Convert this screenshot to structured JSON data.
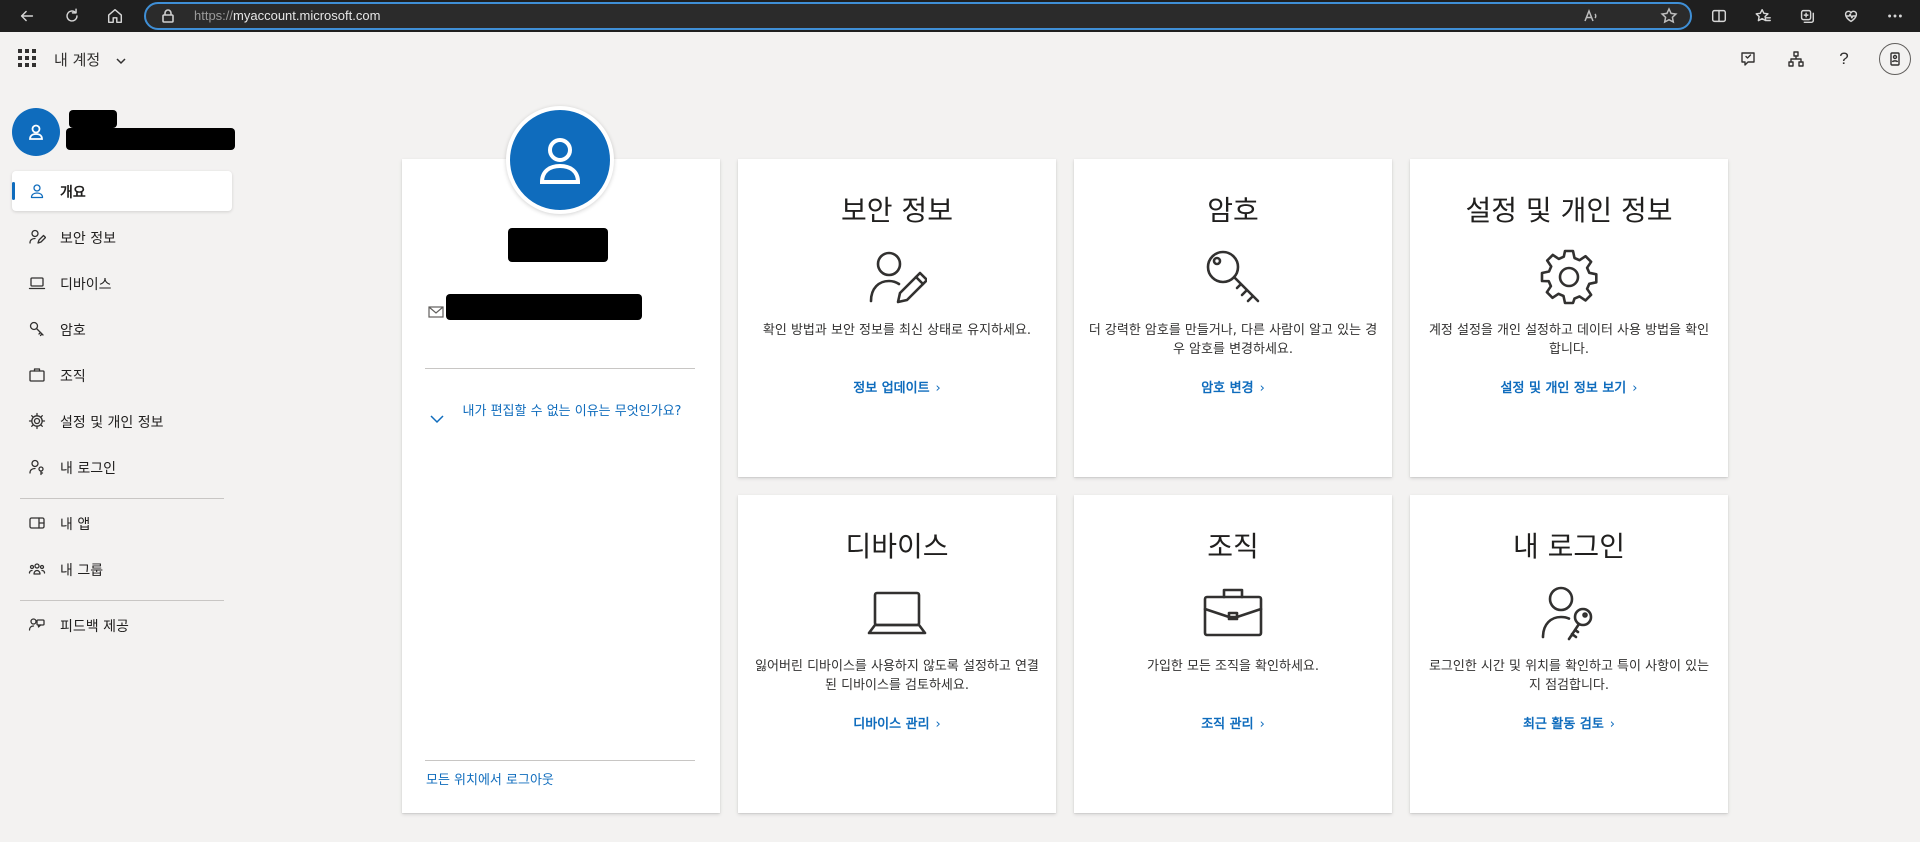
{
  "browser": {
    "url_protocol": "https://",
    "url_host": "myaccount.microsoft.com"
  },
  "header": {
    "app_title": "내 계정",
    "help_label": "?"
  },
  "sidebar": {
    "items": [
      {
        "label": "개요",
        "icon": "person-icon"
      },
      {
        "label": "보안 정보",
        "icon": "security-info-icon"
      },
      {
        "label": "디바이스",
        "icon": "laptop-icon"
      },
      {
        "label": "암호",
        "icon": "key-icon"
      },
      {
        "label": "조직",
        "icon": "briefcase-icon"
      },
      {
        "label": "설정 및 개인 정보",
        "icon": "gear-icon"
      },
      {
        "label": "내 로그인",
        "icon": "sign-in-icon"
      },
      {
        "label": "내 앱",
        "icon": "apps-icon"
      },
      {
        "label": "내 그룹",
        "icon": "groups-icon"
      },
      {
        "label": "피드백 제공",
        "icon": "feedback-icon"
      }
    ],
    "active_index": 0
  },
  "profile": {
    "why_cant_edit": "내가 편집할 수 없는 이유는 무엇인가요?",
    "sign_out_everywhere": "모든 위치에서 로그아웃"
  },
  "tiles": [
    {
      "title": "보안 정보",
      "desc": "확인 방법과 보안 정보를 최신 상태로 유지하세요.",
      "link": "정보 업데이트",
      "icon": "person-pen-icon"
    },
    {
      "title": "암호",
      "desc": "더 강력한 암호를 만들거나, 다른 사람이 알고 있는 경우 암호를 변경하세요.",
      "link": "암호 변경",
      "icon": "key-icon"
    },
    {
      "title": "설정 및 개인 정보",
      "desc": "계정 설정을 개인 설정하고 데이터 사용 방법을 확인합니다.",
      "link": "설정 및 개인 정보 보기",
      "icon": "gear-icon"
    },
    {
      "title": "디바이스",
      "desc": "잃어버린 디바이스를 사용하지 않도록 설정하고 연결된 디바이스를 검토하세요.",
      "link": "디바이스 관리",
      "icon": "laptop-icon"
    },
    {
      "title": "조직",
      "desc": "가입한 모든 조직을 확인하세요.",
      "link": "조직 관리",
      "icon": "briefcase-icon"
    },
    {
      "title": "내 로그인",
      "desc": "로그인한 시간 및 위치를 확인하고 특이 사항이 있는지 점검합니다.",
      "link": "최근 활동 검토",
      "icon": "person-key-icon"
    }
  ],
  "link_chevron": "›",
  "colors": {
    "accent": "#0f6cbd",
    "page_background": "#f3f2f1",
    "browser_bar": "#1f1f1f"
  }
}
